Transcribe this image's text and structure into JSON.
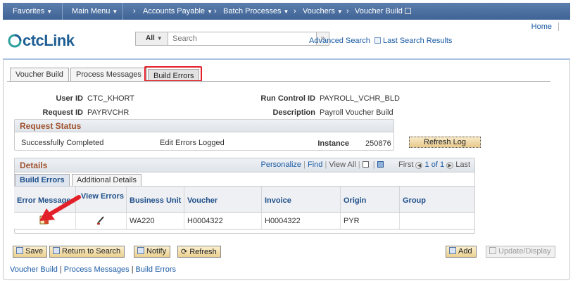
{
  "nav": {
    "favorites": "Favorites",
    "main_menu": "Main Menu",
    "breadcrumbs": [
      "Accounts Payable",
      "Batch Processes",
      "Vouchers",
      "Voucher Build"
    ]
  },
  "header": {
    "logo_text": "ctcLink",
    "home": "Home",
    "search_scope": "All",
    "search_placeholder": "Search",
    "advanced_search": "Advanced Search",
    "last_search_results": "Last Search Results"
  },
  "tabs": [
    {
      "label": "Voucher Build",
      "active": false
    },
    {
      "label": "Process Messages",
      "active": false
    },
    {
      "label": "Build Errors",
      "active": true
    }
  ],
  "fields": {
    "user_id_label": "User ID",
    "user_id": "CTC_KHORT",
    "request_id_label": "Request ID",
    "request_id": "PAYRVCHR",
    "run_control_label": "Run Control ID",
    "run_control": "PAYROLL_VCHR_BLD",
    "description_label": "Description",
    "description": "Payroll Voucher Build"
  },
  "request_status": {
    "title": "Request Status",
    "status": "Successfully Completed",
    "errors": "Edit Errors Logged",
    "instance_label": "Instance",
    "instance": "250876",
    "refresh_log": "Refresh Log"
  },
  "details": {
    "title": "Details",
    "personalize": "Personalize",
    "find": "Find",
    "view_all": "View All",
    "first": "First",
    "range": "1 of 1",
    "last": "Last",
    "tabs": [
      "Build Errors",
      "Additional Details"
    ],
    "columns": [
      "Error Messages",
      "View Errors",
      "Business Unit",
      "Voucher",
      "Invoice",
      "Origin",
      "Group"
    ],
    "rows": [
      {
        "business_unit": "WA220",
        "voucher": "H0004322",
        "invoice": "H0004322",
        "origin": "PYR",
        "group": ""
      }
    ]
  },
  "buttons": {
    "save": "Save",
    "return_to_search": "Return to Search",
    "notify": "Notify",
    "refresh": "Refresh",
    "add": "Add",
    "update_display": "Update/Display"
  },
  "footer_links": [
    "Voucher Build",
    "Process Messages",
    "Build Errors"
  ],
  "colors": {
    "highlight": "#e3202a",
    "accent_link": "#1a5ba4"
  }
}
